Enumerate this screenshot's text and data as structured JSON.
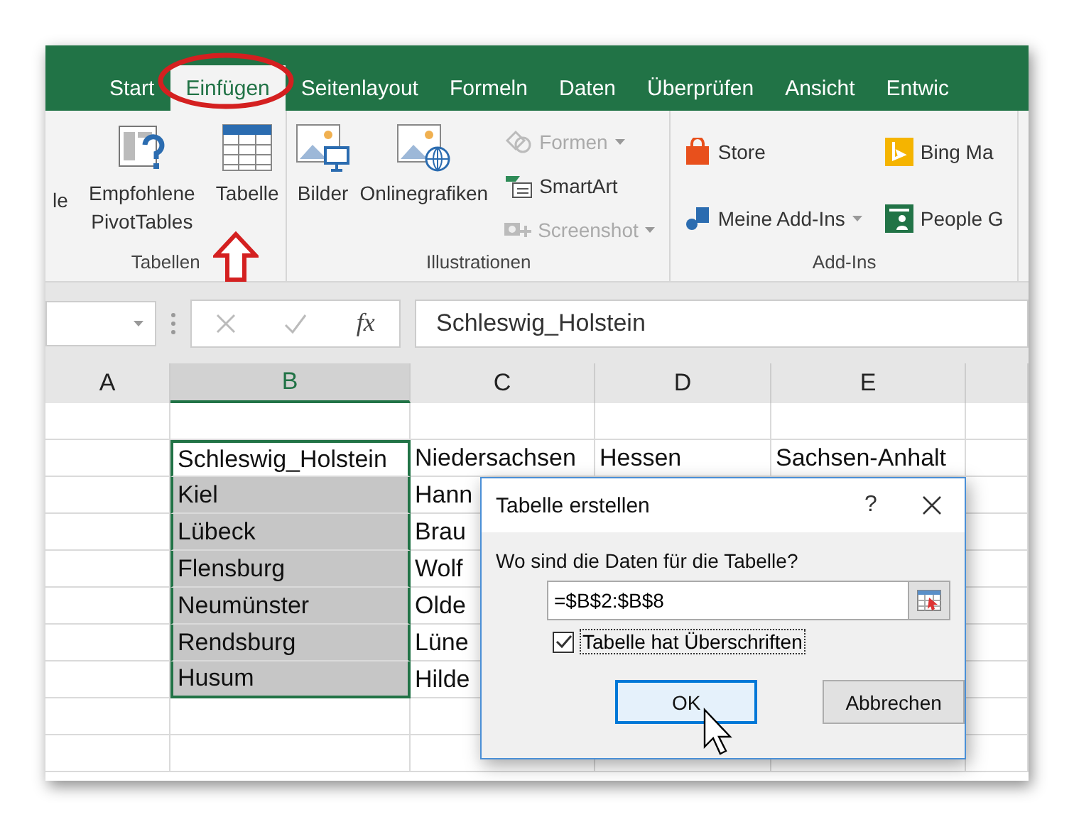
{
  "tabs": [
    {
      "label": "Start",
      "selected": false
    },
    {
      "label": "Einfügen",
      "selected": true
    },
    {
      "label": "Seitenlayout",
      "selected": false
    },
    {
      "label": "Formeln",
      "selected": false
    },
    {
      "label": "Daten",
      "selected": false
    },
    {
      "label": "Überprüfen",
      "selected": false
    },
    {
      "label": "Ansicht",
      "selected": false
    },
    {
      "label": "Entwic",
      "selected": false
    }
  ],
  "ribbon": {
    "groups": [
      {
        "label": "Tabellen",
        "large": [
          {
            "label": "le"
          },
          {
            "label": "Empfohlene PivotTables"
          },
          {
            "label": "Tabelle"
          }
        ]
      },
      {
        "label": "Illustrationen",
        "large": [
          {
            "label": "Bilder"
          },
          {
            "label": "Onlinegrafiken"
          }
        ],
        "columns": [
          [
            {
              "label": "Formen",
              "disabled": true,
              "dropdown": true
            },
            {
              "label": "SmartArt",
              "disabled": false,
              "dropdown": false
            },
            {
              "label": "Screenshot",
              "disabled": true,
              "dropdown": true
            }
          ]
        ]
      },
      {
        "label": "Add-Ins",
        "columns": [
          [
            {
              "label": "Store",
              "disabled": false,
              "dropdown": false
            },
            {
              "label": "Meine Add-Ins",
              "disabled": false,
              "dropdown": true
            }
          ],
          [
            {
              "label": "Bing Ma",
              "disabled": false,
              "dropdown": false
            },
            {
              "label": "People G",
              "disabled": false,
              "dropdown": false
            }
          ]
        ]
      }
    ]
  },
  "formula_bar": {
    "fx": "fx",
    "formula": "Schleswig_Holstein"
  },
  "columns": [
    {
      "label": "A",
      "selected": false
    },
    {
      "label": "B",
      "selected": true
    },
    {
      "label": "C",
      "selected": false
    },
    {
      "label": "D",
      "selected": false
    },
    {
      "label": "E",
      "selected": false
    }
  ],
  "rows": [
    {
      "cells": [
        {
          "text": "Schleswig_Holstein",
          "selected": true,
          "active": true
        },
        {
          "text": "Niedersachsen",
          "selected": false
        },
        {
          "text": "Hessen",
          "selected": false
        },
        {
          "text": "Sachsen-Anhalt",
          "selected": false
        }
      ]
    },
    {
      "cells": [
        {
          "text": "Kiel",
          "selected": true,
          "active": false
        },
        {
          "text": "Hann",
          "selected": false
        }
      ]
    },
    {
      "cells": [
        {
          "text": "Lübeck",
          "selected": true,
          "active": false
        },
        {
          "text": "Brau",
          "selected": false
        }
      ]
    },
    {
      "cells": [
        {
          "text": "Flensburg",
          "selected": true,
          "active": false
        },
        {
          "text": "Wolf",
          "selected": false
        }
      ]
    },
    {
      "cells": [
        {
          "text": "Neumünster",
          "selected": true,
          "active": false
        },
        {
          "text": "Olde",
          "selected": false
        }
      ]
    },
    {
      "cells": [
        {
          "text": "Rendsburg",
          "selected": true,
          "active": false
        },
        {
          "text": "Lüne",
          "selected": false
        }
      ]
    },
    {
      "cells": [
        {
          "text": "Husum",
          "selected": true,
          "active": false
        },
        {
          "text": "Hilde",
          "selected": false
        }
      ]
    }
  ],
  "dialog": {
    "title": "Tabelle erstellen",
    "help": "?",
    "prompt": "Wo sind die Daten für die Tabelle?",
    "range": "=$B$2:$B$8",
    "checkbox": {
      "label": "Tabelle hat Überschriften",
      "checked": true
    },
    "buttons": [
      {
        "label": "OK",
        "default": true
      },
      {
        "label": "Abbrechen",
        "default": false
      }
    ]
  }
}
